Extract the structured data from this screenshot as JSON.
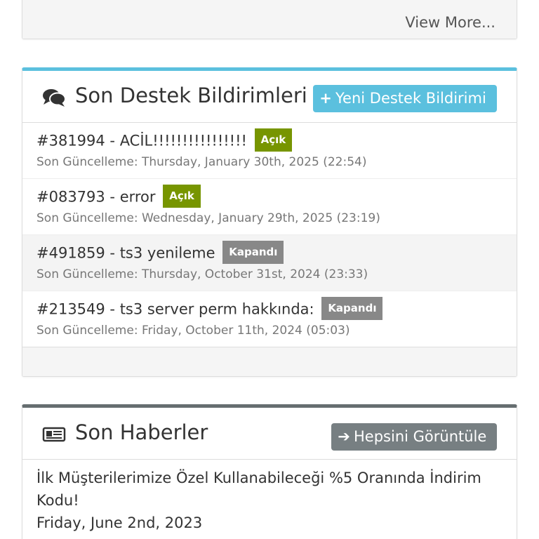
{
  "top_panel": {
    "view_more": "View More..."
  },
  "tickets_panel": {
    "title": "Son Destek Bildirimleri",
    "title_icon": "comments-icon",
    "new_button": {
      "icon": "plus-icon",
      "label": "Yeni Destek Bildirimi"
    },
    "accent_color": "#5bc0de",
    "tickets": [
      {
        "title": "#381994 - ACİL!!!!!!!!!!!!!!!!",
        "status": "Açık",
        "updated": "Son Güncelleme: Thursday, January 30th, 2025 (22:54)"
      },
      {
        "title": "#083793 - error",
        "status": "Açık",
        "updated": "Son Güncelleme: Wednesday, January 29th, 2025 (23:19)"
      },
      {
        "title": "#491859 - ts3 yenileme",
        "status": "Kapandı",
        "updated": "Son Güncelleme: Thursday, October 31st, 2024 (23:33)"
      },
      {
        "title": "#213549 - ts3 server perm hakkında:",
        "status": "Kapandı",
        "updated": "Son Güncelleme: Friday, October 11th, 2024 (05:03)"
      }
    ],
    "status_colors": {
      "open": "#779500",
      "closed": "#888888"
    }
  },
  "news_panel": {
    "title": "Son Haberler",
    "title_icon": "newspaper-icon",
    "view_all_button": {
      "icon": "arrow-right-icon",
      "label": "Hepsini Görüntüle"
    },
    "accent_color": "#666e70",
    "items": [
      {
        "title": "İlk Müşterilerimize Özel Kullanabileceği %5 Oranında İndirim Kodu!",
        "date": "Friday, June 2nd, 2023"
      }
    ]
  }
}
